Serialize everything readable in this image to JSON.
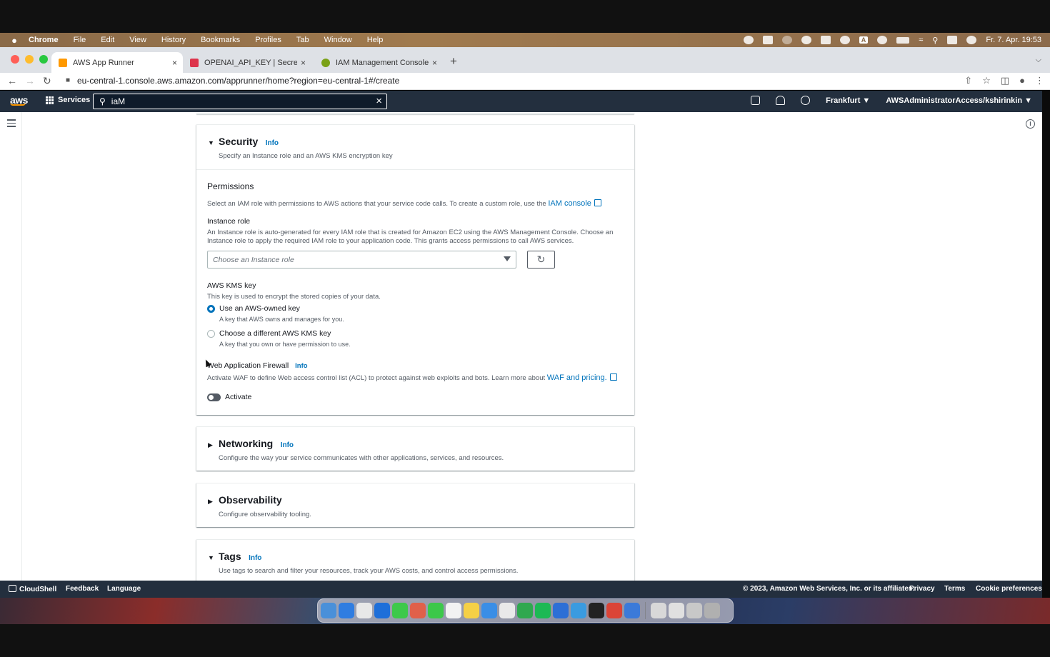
{
  "menubar": {
    "app": "Chrome",
    "items": [
      "File",
      "Edit",
      "View",
      "History",
      "Bookmarks",
      "Profiles",
      "Tab",
      "Window",
      "Help"
    ],
    "input_badge": "A",
    "clock": "Fr. 7. Apr.  19:53"
  },
  "tabs": [
    {
      "title": "AWS App Runner",
      "favicon_color": "#ff9900"
    },
    {
      "title": "OPENAI_API_KEY | Secrets Ma",
      "favicon_color": "#dd344c"
    },
    {
      "title": "IAM Management Console",
      "favicon_color": "#7aa116"
    }
  ],
  "address": {
    "url": "eu-central-1.console.aws.amazon.com/apprunner/home?region=eu-central-1#/create"
  },
  "aws_header": {
    "logo": "aws",
    "services": "Services",
    "search_value": "iaM",
    "region": "Frankfurt ▼",
    "account": "AWSAdministratorAccess/kshirinkin ▼"
  },
  "security": {
    "title": "Security",
    "info": "Info",
    "description": "Specify an Instance role and an AWS KMS encryption key",
    "permissions_heading": "Permissions",
    "permissions_text": "Select an IAM role with permissions to AWS actions that your service code calls. To create a custom role, use the",
    "iam_console_link": "IAM console",
    "instance_role_label": "Instance role",
    "instance_role_help_1": "An Instance role is auto-generated for every IAM role that is created for Amazon EC2 using the AWS Management Console. Choose an",
    "instance_role_help_2": "Instance role to apply the required IAM role to your application code. This grants access permissions to call AWS services.",
    "instance_role_placeholder": "Choose an Instance role",
    "kms_label": "AWS KMS key",
    "kms_help": "This key is used to encrypt the stored copies of your data.",
    "kms_options": [
      {
        "label": "Use an AWS-owned key",
        "desc": "A key that AWS owns and manages for you.",
        "selected": true
      },
      {
        "label": "Choose a different AWS KMS key",
        "desc": "A key that you own or have permission to use.",
        "selected": false
      }
    ],
    "waf_label": "Web Application Firewall",
    "waf_info": "Info",
    "waf_text": "Activate WAF to define Web access control list (ACL) to protect against web exploits and bots. Learn more about",
    "waf_link": "WAF and pricing.",
    "activate_label": "Activate"
  },
  "networking": {
    "title": "Networking",
    "info": "Info",
    "description": "Configure the way your service communicates with other applications, services, and resources."
  },
  "observability": {
    "title": "Observability",
    "description": "Configure observability tooling."
  },
  "tags": {
    "title": "Tags",
    "info": "Info",
    "description": "Use tags to search and filter your resources, track your AWS costs, and control access permissions."
  },
  "footer": {
    "cloudshell": "CloudShell",
    "feedback": "Feedback",
    "language": "Language",
    "copyright": "© 2023, Amazon Web Services, Inc. or its affiliates.",
    "privacy": "Privacy",
    "terms": "Terms",
    "cookies": "Cookie preferences"
  },
  "dock_apps": [
    "#4a90d9",
    "#2f7de1",
    "#e8e8e8",
    "#1e6fd9",
    "#3dc94a",
    "#e0604a",
    "#3cc84a",
    "#f2f2f2",
    "#f5d046",
    "#3a8ee6",
    "#e9e9e9",
    "#2fa84f",
    "#1db954",
    "#2d6fd6",
    "#3a9be0",
    "#222222",
    "#db4437",
    "#3b7ad9",
    "#d8d8d8",
    "#e0e0e0",
    "#c8c8c8",
    "#b0b0b0"
  ]
}
